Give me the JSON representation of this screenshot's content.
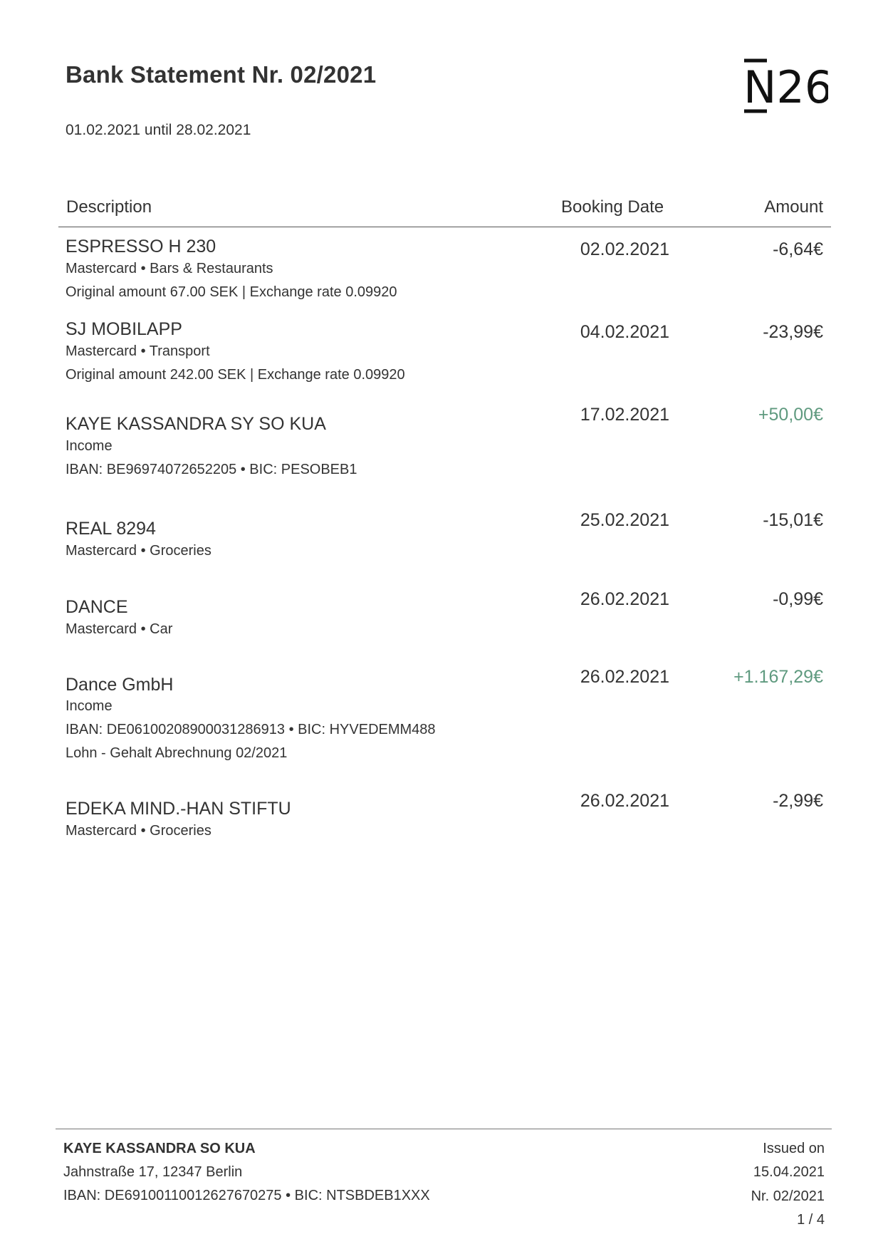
{
  "header": {
    "title": "Bank Statement Nr. 02/2021",
    "period": "01.02.2021 until 28.02.2021",
    "logo_text": "N26"
  },
  "table": {
    "columns": [
      "Description",
      "Booking Date",
      "Amount"
    ],
    "transactions": [
      {
        "name": "ESPRESSO H 230",
        "lines": [
          "Mastercard • Bars & Restaurants",
          "Original amount 67.00 SEK | Exchange rate 0.09920"
        ],
        "date": "02.02.2021",
        "amount": "-6,64€"
      },
      {
        "name": "SJ MOBILAPP",
        "lines": [
          "Mastercard • Transport",
          "Original amount 242.00 SEK | Exchange rate 0.09920"
        ],
        "date": "04.02.2021",
        "amount": "-23,99€"
      },
      {
        "name": "KAYE KASSANDRA SY SO KUA",
        "lines": [
          "Income",
          "IBAN: BE96974072652205 • BIC: PESOBEB1"
        ],
        "date": "17.02.2021",
        "amount": "+50,00€"
      },
      {
        "name": "REAL 8294",
        "lines": [
          "Mastercard • Groceries"
        ],
        "date": "25.02.2021",
        "amount": "-15,01€"
      },
      {
        "name": "DANCE",
        "lines": [
          "Mastercard • Car"
        ],
        "date": "26.02.2021",
        "amount": "-0,99€"
      },
      {
        "name": "Dance GmbH",
        "lines": [
          "Income",
          "IBAN: DE06100208900031286913 • BIC: HYVEDEMM488",
          "Lohn - Gehalt Abrechnung 02/2021"
        ],
        "date": "26.02.2021",
        "amount": "+1.167,29€"
      },
      {
        "name": "EDEKA MIND.-HAN STIFTU",
        "lines": [
          "Mastercard • Groceries"
        ],
        "date": "26.02.2021",
        "amount": "-2,99€"
      }
    ]
  },
  "footer": {
    "name": "KAYE KASSANDRA SO KUA",
    "address": "Jahnstraße 17, 12347 Berlin",
    "iban": "IBAN: DE69100110012627670275 • BIC: NTSBDEB1XXX",
    "issued_label": "Issued on",
    "issued_date": "15.04.2021",
    "statement_no": "Nr. 02/2021",
    "page": "1 / 4"
  },
  "colors": {
    "text": "#333333",
    "positive": "#5f9a7f",
    "rule": "#555555"
  }
}
